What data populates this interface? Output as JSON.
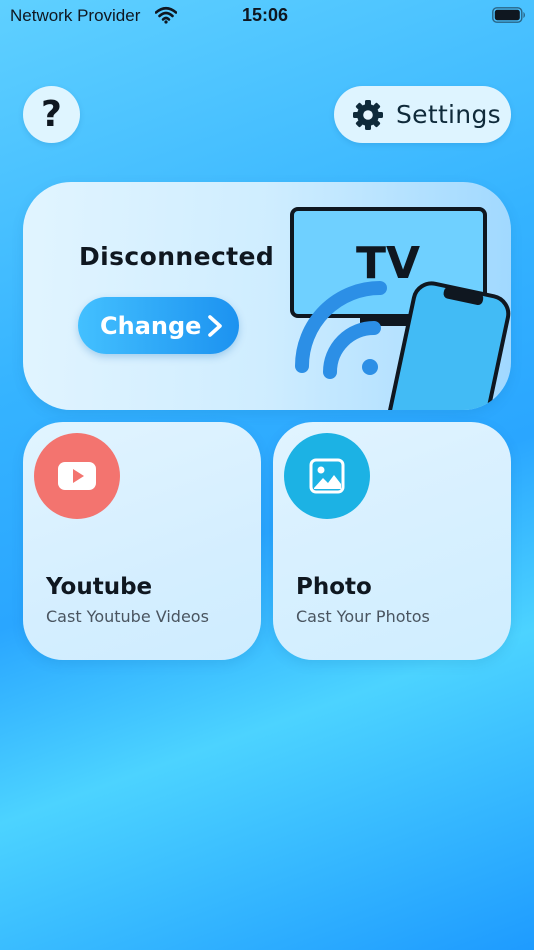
{
  "status_bar": {
    "carrier": "Network Provider",
    "time": "15:06",
    "wifi_icon": "wifi-icon",
    "battery_icon": "battery-icon"
  },
  "top_bar": {
    "help_label": "?",
    "settings_label": "Settings",
    "settings_icon": "gear-icon"
  },
  "connection": {
    "status": "Disconnected",
    "change_label": "Change",
    "illustration_text": "TV",
    "illustration_icon": "tv-phone-cast-illustration"
  },
  "features": [
    {
      "title": "Youtube",
      "subtitle": "Cast Youtube Videos",
      "icon": "youtube-icon",
      "color": "#f3746f"
    },
    {
      "title": "Photo",
      "subtitle": "Cast Your Photos",
      "icon": "photo-icon",
      "color": "#1cb2e4"
    }
  ],
  "colors": {
    "background_top": "#5fd0ff",
    "background_bottom": "#1e9bff",
    "accent": "#1c92f0"
  }
}
